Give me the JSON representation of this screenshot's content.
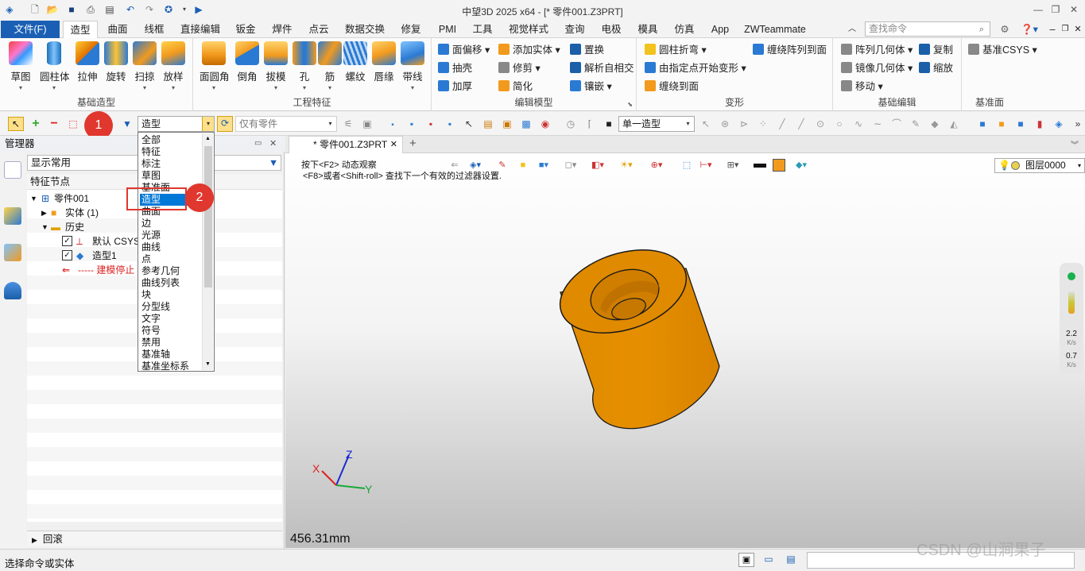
{
  "titlebar": {
    "title": "中望3D 2025 x64 - [* 零件001.Z3PRT]"
  },
  "menu": {
    "file": "文件(F)",
    "tabs": [
      "造型",
      "曲面",
      "线框",
      "直接编辑",
      "钣金",
      "焊件",
      "点云",
      "数据交换",
      "修复",
      "PMI",
      "工具",
      "视觉样式",
      "查询",
      "电极",
      "模具",
      "仿真",
      "App",
      "ZWTeammate"
    ],
    "search_placeholder": "查找命令"
  },
  "ribbon": {
    "group1": {
      "label": "基础造型",
      "buttons": [
        "草图",
        "圆柱体",
        "拉伸",
        "旋转",
        "扫掠",
        "放样"
      ]
    },
    "group2": {
      "label": "工程特征",
      "buttons": [
        "面圆角",
        "倒角",
        "拔模",
        "孔",
        "筋",
        "螺纹",
        "唇缘",
        "带线"
      ]
    },
    "group3": {
      "label": "编辑模型",
      "items": [
        "面偏移",
        "添加实体",
        "置换",
        "抽壳",
        "修剪",
        "解析自相交",
        "加厚",
        "简化",
        "镶嵌"
      ]
    },
    "group4": {
      "label": "变形",
      "items": [
        "圆柱折弯",
        "缠绕阵列到面",
        "由指定点开始变形",
        "缠绕到面"
      ]
    },
    "group5": {
      "label": "基础编辑",
      "items": [
        "阵列几何体",
        "复制",
        "镜像几何体",
        "缩放",
        "移动"
      ]
    },
    "group6": {
      "label": "基准面",
      "items": [
        "基准CSYS"
      ]
    }
  },
  "toolbar2": {
    "filter_value": "造型",
    "scope_value": "仅有零件",
    "select_mode": "单一造型"
  },
  "callouts": [
    "1",
    "2"
  ],
  "filter_dropdown": {
    "options": [
      "全部",
      "特征",
      "标注",
      "草图",
      "基准面",
      "造型",
      "曲面",
      "边",
      "光源",
      "曲线",
      "点",
      "参考几何",
      "曲线列表",
      "块",
      "分型线",
      "文字",
      "符号",
      "禁用",
      "基准轴",
      "基准坐标系"
    ],
    "selected": "造型"
  },
  "manager": {
    "title": "管理器",
    "display": "显示常用",
    "header": "特征节点",
    "tree": {
      "root": "零件001",
      "solid": "实体 (1)",
      "history": "历史",
      "csys": "默认 CSYS",
      "shape": "造型1",
      "stop": "----- 建模停止"
    },
    "footer": "回滚"
  },
  "viewport": {
    "tab": "* 零件001.Z3PRT",
    "hint1": "按下<F2> 动态观察",
    "hint2": "<F8>或者<Shift-roll> 查找下一个有效的过滤器设置.",
    "layer": "图层0000",
    "measure": "456.31mm",
    "speed1": "2.2",
    "speed2": "0.7",
    "speed_unit": "K/s",
    "axes": {
      "x": "X",
      "y": "Y",
      "z": "Z"
    },
    "colors": {
      "part": "#e08a00",
      "edge": "#1a1a1a"
    }
  },
  "status": {
    "text": "选择命令或实体"
  },
  "watermark": "CSDN @山涧果子"
}
